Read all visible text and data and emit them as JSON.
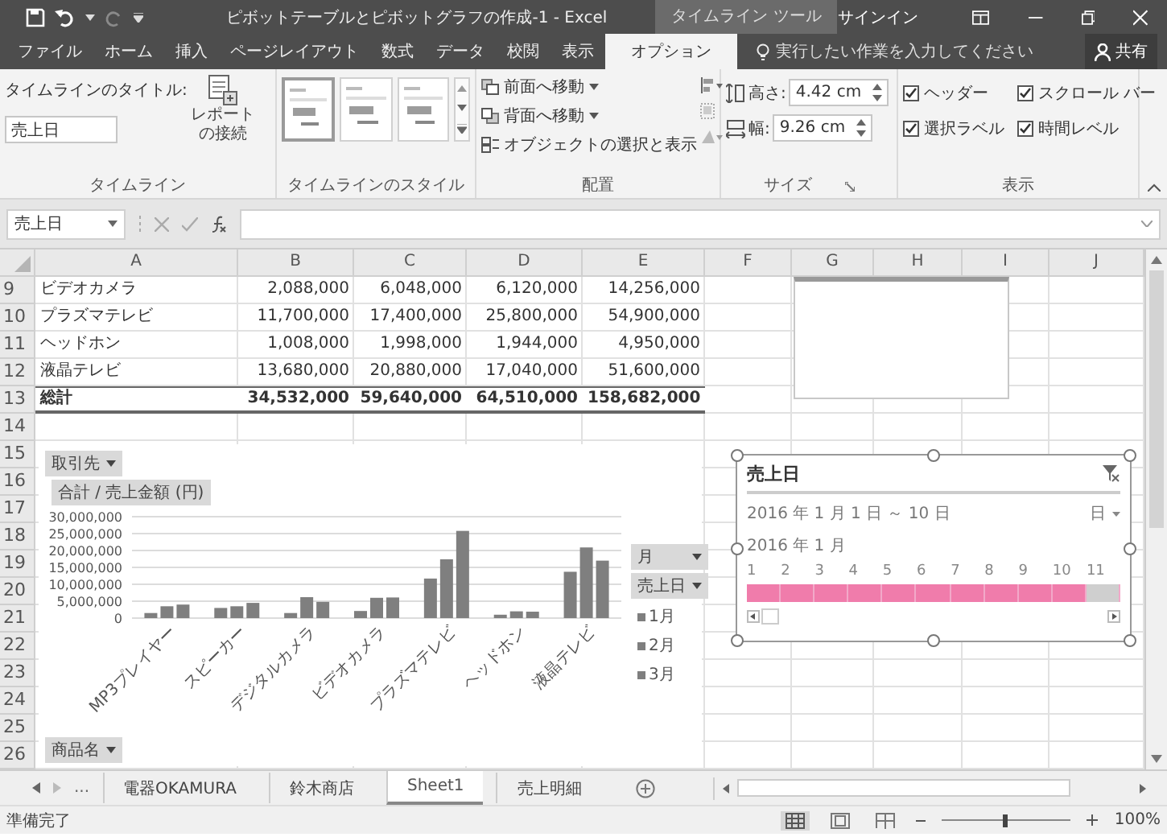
{
  "title_bar": {
    "title": "ピボットテーブルとピボットグラフの作成-1 - Excel",
    "context_tools": "タイムライン ツール",
    "sign_in": "サインイン"
  },
  "ribbon_tabs": [
    {
      "label": "ファイル",
      "selected": false
    },
    {
      "label": "ホーム",
      "selected": false
    },
    {
      "label": "挿入",
      "selected": false
    },
    {
      "label": "ページレイアウト",
      "selected": false
    },
    {
      "label": "数式",
      "selected": false
    },
    {
      "label": "データ",
      "selected": false
    },
    {
      "label": "校閲",
      "selected": false
    },
    {
      "label": "表示",
      "selected": false
    },
    {
      "label": "オプション",
      "selected": true
    }
  ],
  "tell_me": {
    "placeholder": "実行したい作業を入力してください"
  },
  "share": "共有",
  "timeline_group": {
    "label": "タイムライン",
    "title_label": "タイムラインのタイトル:",
    "title_value": "売上日",
    "report_connection": [
      "レポート",
      "の接続"
    ]
  },
  "style_group": {
    "label": "タイムラインのスタイル",
    "styles": [
      {
        "selected": true
      },
      {
        "selected": false
      },
      {
        "selected": false
      }
    ]
  },
  "arrange_group": {
    "label": "配置",
    "buttons": [
      {
        "label": "前面へ移動",
        "has_menu": true
      },
      {
        "label": "背面へ移動",
        "has_menu": true
      },
      {
        "label": "オブジェクトの選択と表示",
        "has_menu": false
      }
    ]
  },
  "size_group": {
    "label": "サイズ",
    "height_label": "高さ:",
    "height": "4.42 cm",
    "width_label": "幅:",
    "width": "9.26 cm"
  },
  "show_group": {
    "label": "表示",
    "options": [
      {
        "label": "ヘッダー",
        "checked": true
      },
      {
        "label": "スクロール バー",
        "checked": true
      },
      {
        "label": "選択ラベル",
        "checked": true
      },
      {
        "label": "時間レベル",
        "checked": true
      }
    ]
  },
  "name_box": "売上日",
  "columns": [
    "A",
    "B",
    "C",
    "D",
    "E",
    "F",
    "G",
    "H",
    "I",
    "J"
  ],
  "rows": [
    {
      "number": "9",
      "total": false,
      "cells": [
        "ビデオカメラ",
        "2,088,000",
        "6,048,000",
        "6,120,000",
        "14,256,000"
      ]
    },
    {
      "number": "10",
      "total": false,
      "cells": [
        "プラズマテレビ",
        "11,700,000",
        "17,400,000",
        "25,800,000",
        "54,900,000"
      ]
    },
    {
      "number": "11",
      "total": false,
      "cells": [
        "ヘッドホン",
        "1,008,000",
        "1,998,000",
        "1,944,000",
        "4,950,000"
      ]
    },
    {
      "number": "12",
      "total": false,
      "cells": [
        "液晶テレビ",
        "13,680,000",
        "20,880,000",
        "17,040,000",
        "51,600,000"
      ]
    },
    {
      "number": "13",
      "total": true,
      "cells": [
        "総計",
        "34,532,000",
        "59,640,000",
        "64,510,000",
        "158,682,000"
      ]
    }
  ],
  "blank_rows": [
    "14",
    "15",
    "16",
    "17",
    "18",
    "19",
    "20",
    "21",
    "22",
    "23",
    "24",
    "25",
    "26"
  ],
  "pivot_chart": {
    "filter_field": "取引先",
    "value_field": "合計 / 売上金額 (円)",
    "axis_field": "商品名",
    "legend_fields": [
      "月",
      "売上日"
    ],
    "chart_data": {
      "type": "bar",
      "categories": [
        "MP3プレイヤー",
        "スピーカー",
        "デジタルカメラ",
        "ビデオカメラ",
        "プラズマテレビ",
        "ヘッドホン",
        "液晶テレビ"
      ],
      "series": [
        {
          "name": "1月",
          "color": "#7f7f7f",
          "values": [
            1500000,
            3000000,
            1500000,
            2100000,
            11700000,
            1000000,
            13700000
          ]
        },
        {
          "name": "2月",
          "color": "#7f7f7f",
          "values": [
            3500000,
            3500000,
            6200000,
            6000000,
            17400000,
            2000000,
            20900000
          ]
        },
        {
          "name": "3月",
          "color": "#7f7f7f",
          "values": [
            4000000,
            4500000,
            4800000,
            6100000,
            25800000,
            1900000,
            17000000
          ]
        }
      ],
      "grid": true,
      "ylim": [
        0,
        30000000
      ],
      "yticks": [
        {
          "value": 0,
          "label": "0"
        },
        {
          "value": 5000000,
          "label": "5,000,000"
        },
        {
          "value": 10000000,
          "label": "10,000,000"
        },
        {
          "value": 15000000,
          "label": "15,000,000"
        },
        {
          "value": 20000000,
          "label": "20,000,000"
        },
        {
          "value": 25000000,
          "label": "25,000,000"
        },
        {
          "value": 30000000,
          "label": "30,000,000"
        }
      ]
    }
  },
  "timeline": {
    "title": "売上日",
    "range": "2016 年 1 月 1 日 ～ 10 日",
    "time_level": "日",
    "period": "2016 年 1 月",
    "days": [
      {
        "label": "1",
        "selected": true
      },
      {
        "label": "2",
        "selected": true
      },
      {
        "label": "3",
        "selected": true
      },
      {
        "label": "4",
        "selected": true
      },
      {
        "label": "5",
        "selected": true
      },
      {
        "label": "6",
        "selected": true
      },
      {
        "label": "7",
        "selected": true
      },
      {
        "label": "8",
        "selected": true
      },
      {
        "label": "9",
        "selected": true
      },
      {
        "label": "10",
        "selected": true
      },
      {
        "label": "11",
        "selected": false
      }
    ]
  },
  "sheet_tabs": {
    "more": "...",
    "tabs": [
      {
        "label": "電器OKAMURA",
        "selected": false
      },
      {
        "label": "鈴木商店",
        "selected": false
      },
      {
        "label": "Sheet1",
        "selected": true
      },
      {
        "label": "売上明細",
        "selected": false
      }
    ]
  },
  "status_bar": {
    "text": "準備完了",
    "views": [
      {
        "kind": "normal",
        "selected": true
      },
      {
        "kind": "page_layout",
        "selected": false
      },
      {
        "kind": "page_break",
        "selected": false
      }
    ],
    "zoom_slider": {
      "level": 0.5
    },
    "zoom": "100%"
  }
}
